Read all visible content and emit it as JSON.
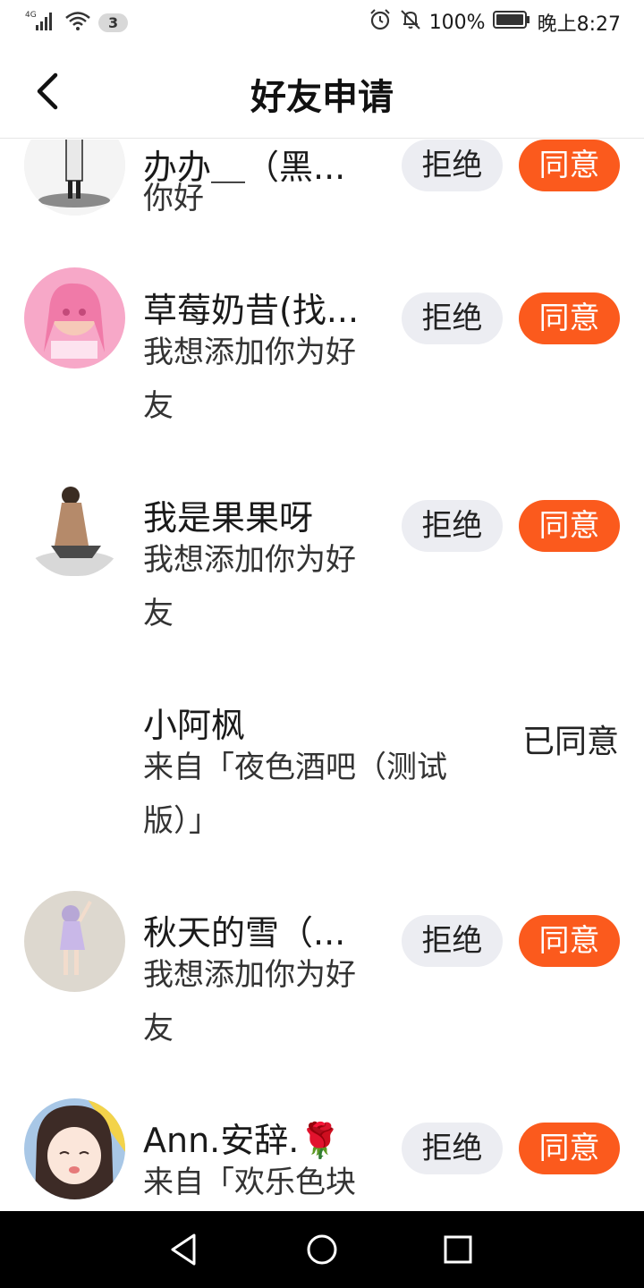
{
  "status_bar": {
    "network": "4G",
    "notification_count": "3",
    "battery": "100%",
    "time": "晚上8:27"
  },
  "header": {
    "title": "好友申请"
  },
  "requests": [
    {
      "name": "办办＿（黑...",
      "message": "你好",
      "reject_label": "拒绝",
      "accept_label": "同意"
    },
    {
      "name": "草莓奶昔(找...",
      "message": "我想添加你为好友",
      "reject_label": "拒绝",
      "accept_label": "同意"
    },
    {
      "name": "我是果果呀",
      "message": "我想添加你为好友",
      "reject_label": "拒绝",
      "accept_label": "同意"
    },
    {
      "name": "小阿枫",
      "message": "来自「夜色酒吧（测试版）」",
      "status": "已同意"
    },
    {
      "name": "秋天的雪（...",
      "message": "我想添加你为好友",
      "reject_label": "拒绝",
      "accept_label": "同意"
    },
    {
      "name": "Ann.安辞.🌹",
      "message": "来自「欢乐色块",
      "reject_label": "拒绝",
      "accept_label": "同意"
    }
  ],
  "colors": {
    "accent": "#fb5a1d",
    "reject_bg": "#ecedf2"
  }
}
